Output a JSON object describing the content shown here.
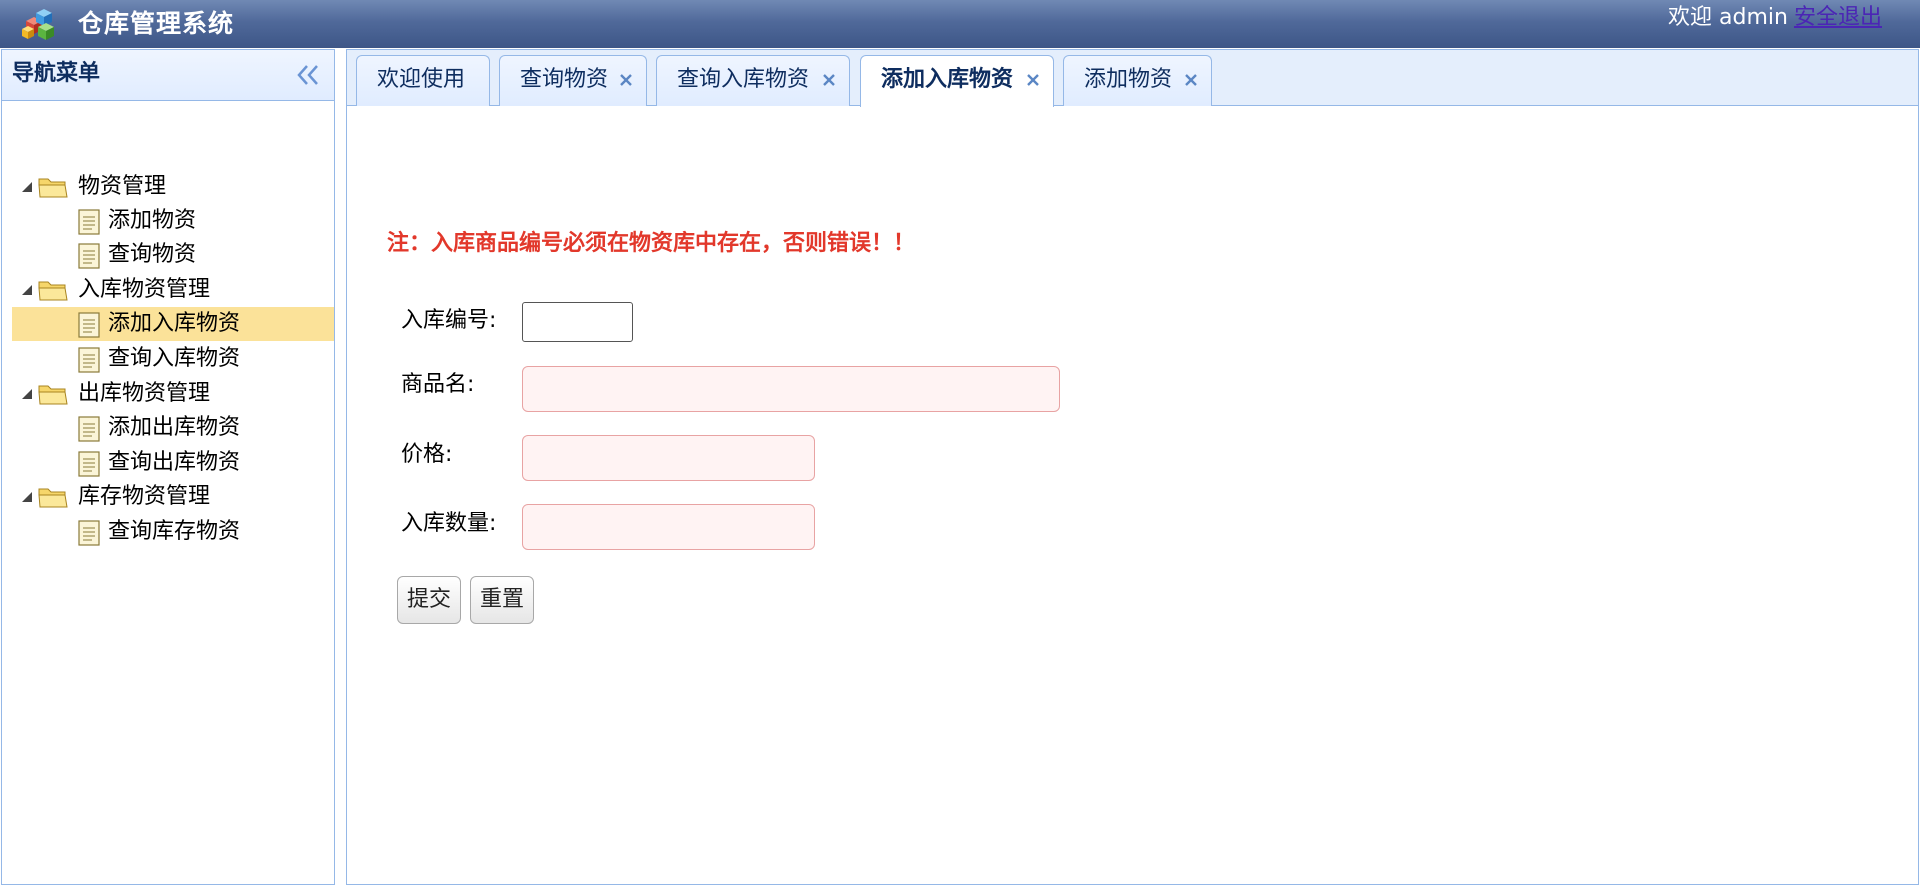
{
  "header": {
    "title": "仓库管理系统",
    "welcome": "欢迎 admin",
    "logout": "安全退出",
    "logo_icon": "cubes-logo-icon"
  },
  "sidebar": {
    "title": "导航菜单",
    "collapse_icon": "double-chevron-left-icon",
    "tree": [
      {
        "label": "物资管理",
        "type": "folder",
        "expanded": true
      },
      {
        "label": "添加物资",
        "type": "leaf"
      },
      {
        "label": "查询物资",
        "type": "leaf"
      },
      {
        "label": "入库物资管理",
        "type": "folder",
        "expanded": true
      },
      {
        "label": "添加入库物资",
        "type": "leaf",
        "selected": true
      },
      {
        "label": "查询入库物资",
        "type": "leaf"
      },
      {
        "label": "出库物资管理",
        "type": "folder",
        "expanded": true
      },
      {
        "label": "添加出库物资",
        "type": "leaf"
      },
      {
        "label": "查询出库物资",
        "type": "leaf"
      },
      {
        "label": "库存物资管理",
        "type": "folder",
        "expanded": true
      },
      {
        "label": "查询库存物资",
        "type": "leaf"
      }
    ]
  },
  "tabs": [
    {
      "label": "欢迎使用",
      "closable": false,
      "active": false
    },
    {
      "label": "查询物资",
      "closable": true,
      "active": false
    },
    {
      "label": "查询入库物资",
      "closable": true,
      "active": false
    },
    {
      "label": "添加入库物资",
      "closable": true,
      "active": true
    },
    {
      "label": "添加物资",
      "closable": true,
      "active": false
    }
  ],
  "form": {
    "notice": "注：入库商品编号必须在物资库中存在，否则错误！！",
    "fields": [
      {
        "label": "入库编号:",
        "value": "",
        "state": "normal"
      },
      {
        "label": "商品名:",
        "value": "",
        "state": "invalid"
      },
      {
        "label": "价格:",
        "value": "",
        "state": "invalid"
      },
      {
        "label": "入库数量:",
        "value": "",
        "state": "invalid"
      }
    ],
    "submit_label": "提交",
    "reset_label": "重置"
  },
  "colors": {
    "header": "#50699a",
    "panel_border": "#95b8e7",
    "selected_node": "#fbe299",
    "notice_text": "#e2382b",
    "invalid_bg": "#fff3f3",
    "invalid_border": "#e8a3a3",
    "logout_link": "#4b25b5"
  }
}
